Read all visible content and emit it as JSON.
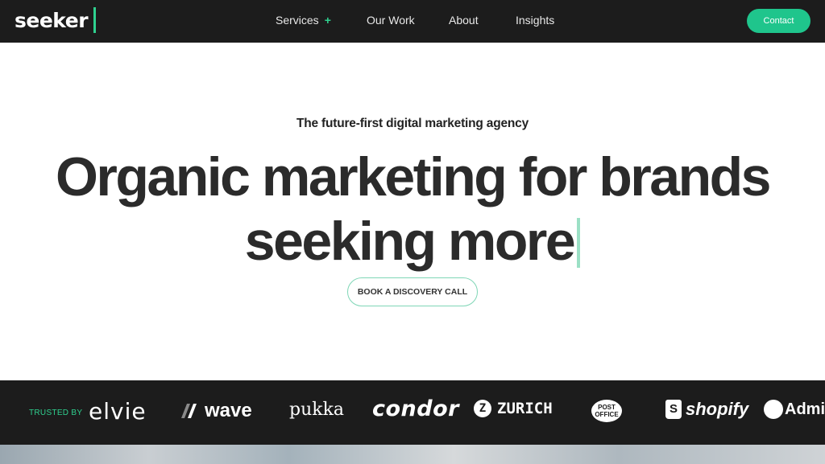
{
  "nav": {
    "logo": "seeker",
    "links": [
      "Services",
      "Our Work",
      "About",
      "Insights"
    ],
    "services_plus": "+",
    "contact": "Contact"
  },
  "hero": {
    "tagline": "The future-first digital marketing agency",
    "headline_line1": "Organic marketing for brands",
    "headline_line2": "seeking more",
    "cta": "BOOK A DISCOVERY CALL"
  },
  "trusted": {
    "label": "TRUSTED BY",
    "brands": {
      "elvie": "elvie",
      "wave": "wave",
      "pukka": "pukka",
      "condor": "condor",
      "zurich": "ZURICH",
      "post_office_1": "POST",
      "post_office_2": "OFFICE",
      "shopify": "shopify",
      "admiral": "Admi"
    }
  },
  "colors": {
    "accent": "#1fc58c",
    "dark": "#1c1c1c"
  }
}
